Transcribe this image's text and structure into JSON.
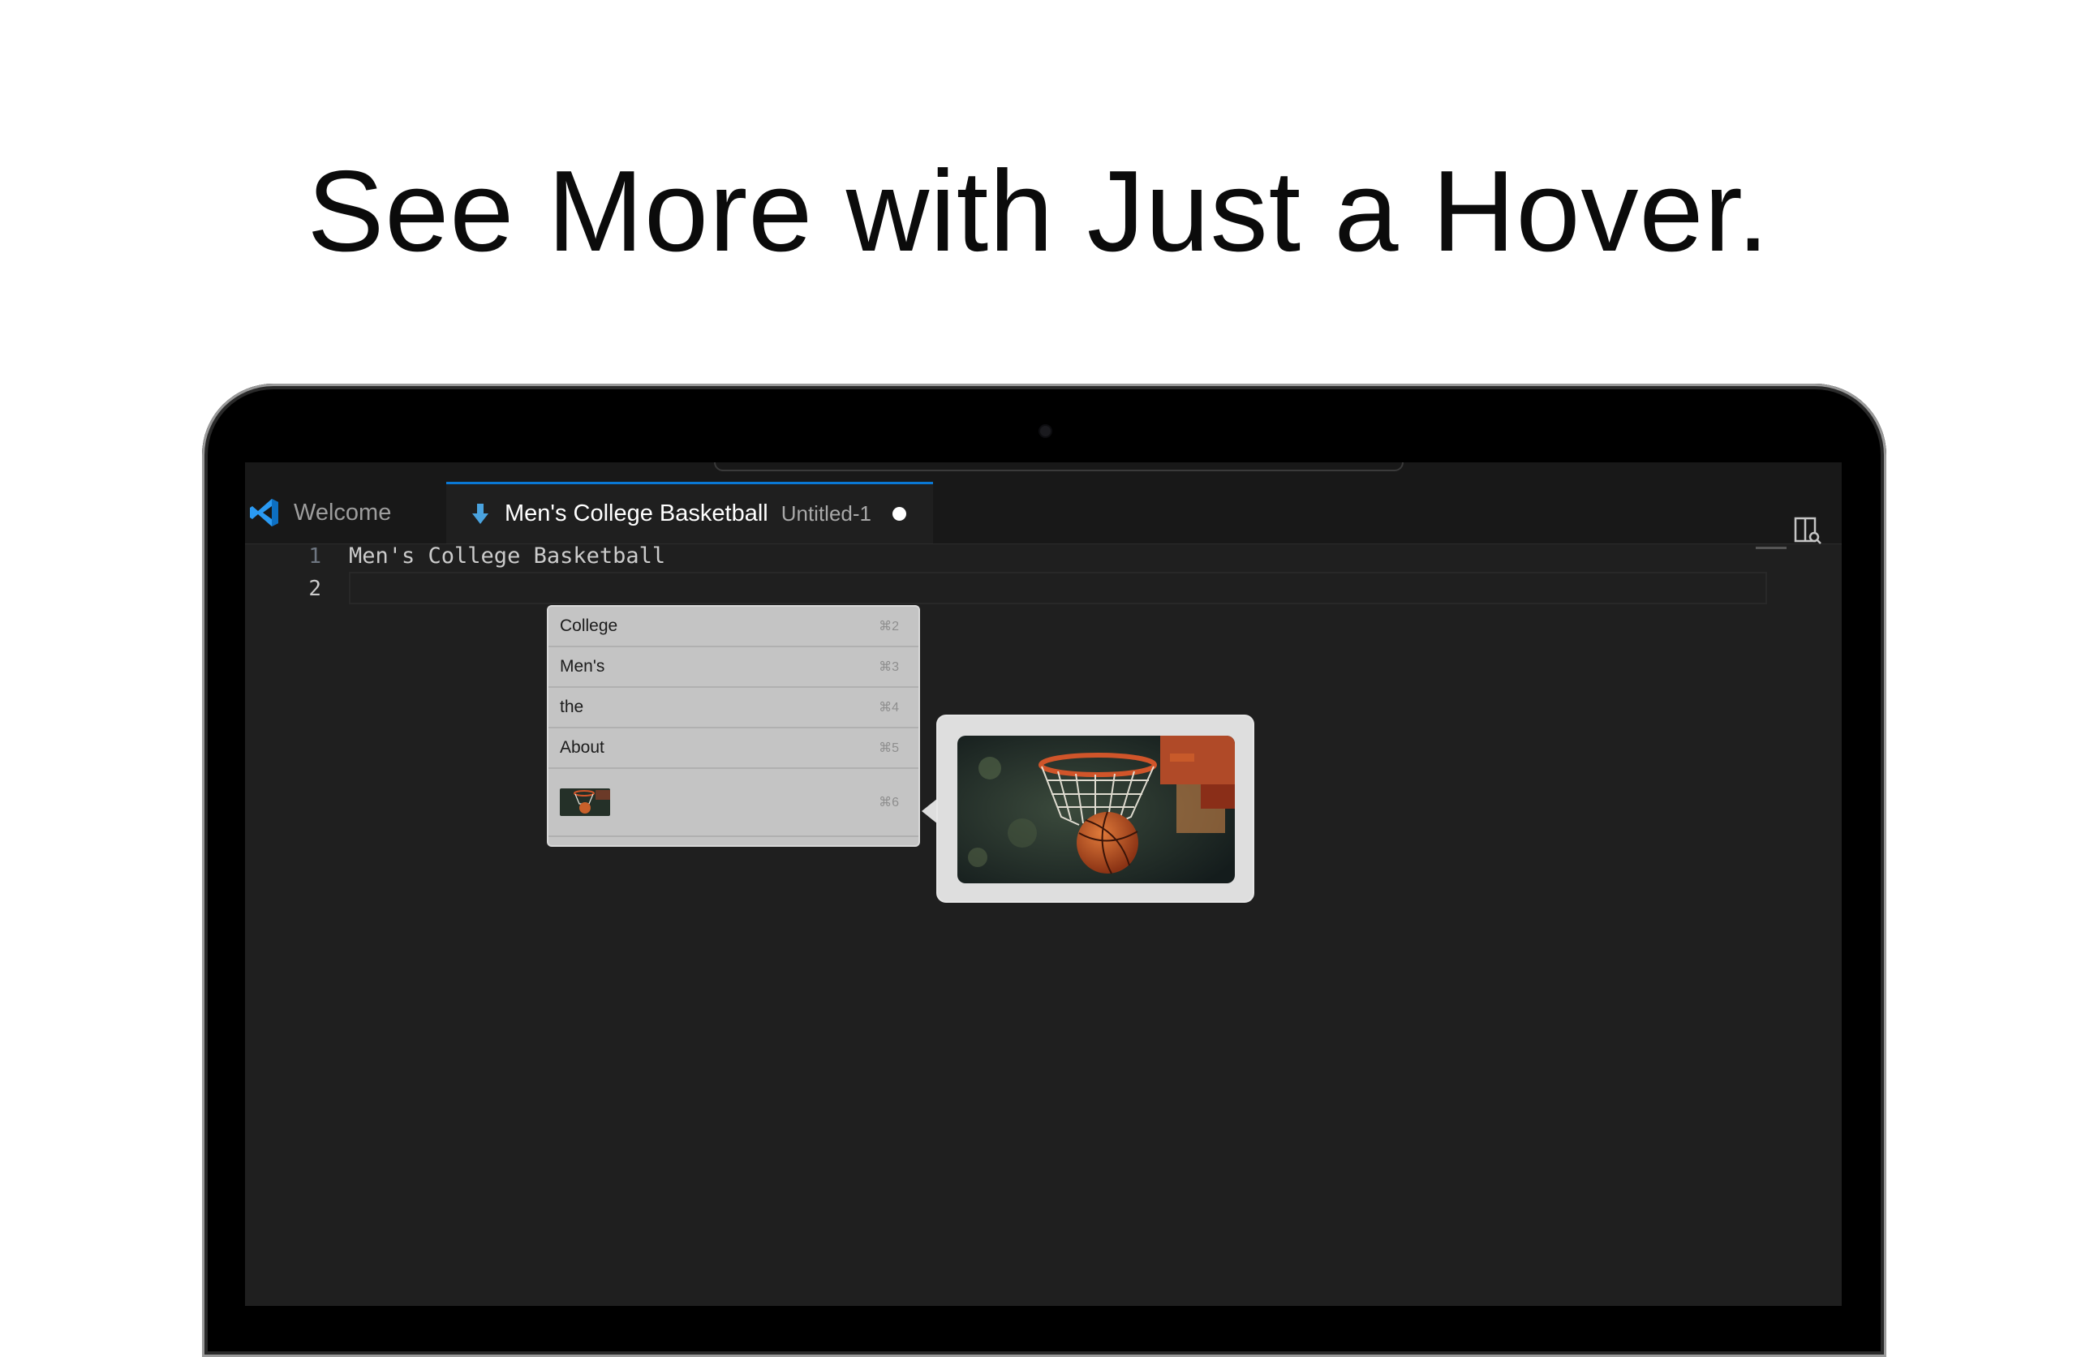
{
  "headline": "See More with Just a Hover.",
  "tabs": {
    "welcome_label": "Welcome",
    "active_title": "Men's College Basketball",
    "active_description": "Untitled-1"
  },
  "editor": {
    "lines": [
      {
        "number": "1",
        "text": "Men's College Basketball"
      },
      {
        "number": "2",
        "text": ""
      }
    ]
  },
  "suggestions": [
    {
      "label": "College",
      "shortcut": "⌘2"
    },
    {
      "label": "Men's",
      "shortcut": "⌘3"
    },
    {
      "label": "the",
      "shortcut": "⌘4"
    },
    {
      "label": "About",
      "shortcut": "⌘5"
    },
    {
      "label": "",
      "shortcut": "⌘6",
      "type": "image",
      "image": "basketball-hoop-thumbnail"
    }
  ],
  "hover_preview": {
    "image": "basketball-going-through-hoop"
  },
  "colors": {
    "accent": "#0a78d4",
    "editor_bg": "#1f1f1f",
    "tabbar_bg": "#181818",
    "suggest_bg": "#c4c4c4"
  }
}
